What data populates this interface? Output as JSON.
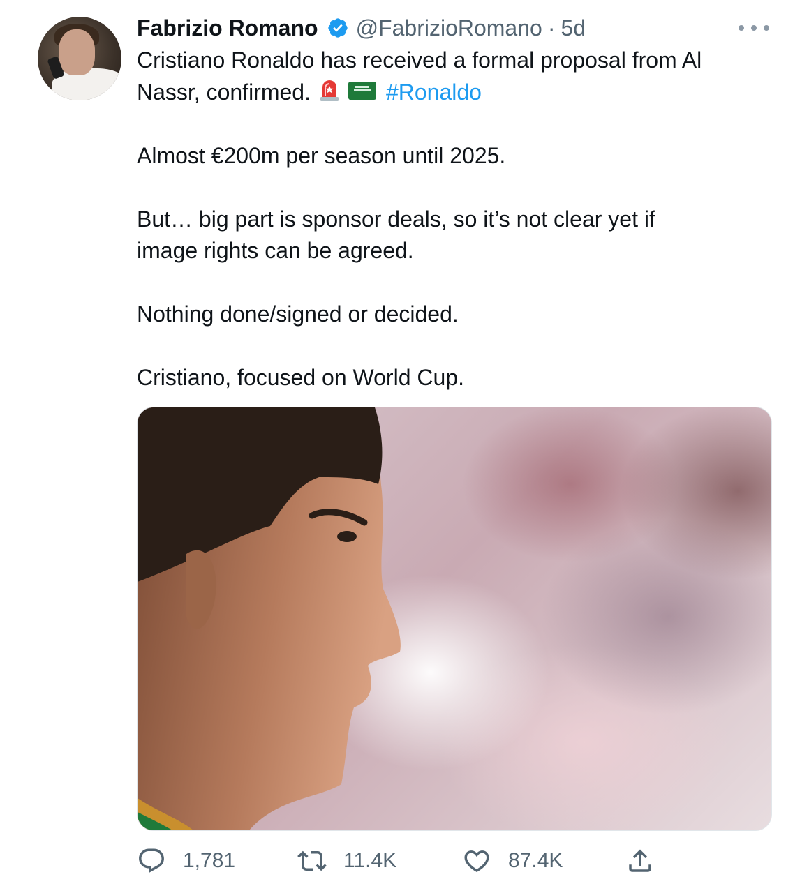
{
  "author": {
    "name": "Fabrizio Romano",
    "handle": "@FabrizioRomano",
    "separator": "·",
    "time": "5d"
  },
  "tweet": {
    "line1": "Cristiano Ronaldo has received a formal proposal from Al",
    "line2_text": "Nassr, confirmed.",
    "hashtag": "#Ronaldo",
    "para2": "Almost €200m per season until 2025.",
    "para3a": "But… big part is sponsor deals, so it’s not clear yet if",
    "para3b": "image rights can be agreed.",
    "para4": "Nothing done/signed or decided.",
    "para5": "Cristiano, focused on World Cup."
  },
  "icons": {
    "verified": "verified-badge-icon",
    "more": "more-options-icon",
    "siren": "rotating-light-emoji",
    "flag": "saudi-arabia-flag-emoji",
    "reply": "reply-icon",
    "retweet": "retweet-icon",
    "like": "heart-icon",
    "share": "share-icon"
  },
  "actions": {
    "replies": "1,781",
    "retweets": "11.4K",
    "likes": "87.4K"
  },
  "colors": {
    "text": "#0f1419",
    "secondary": "#536471",
    "link": "#1d9bf0",
    "verified": "#1d9bf0"
  }
}
